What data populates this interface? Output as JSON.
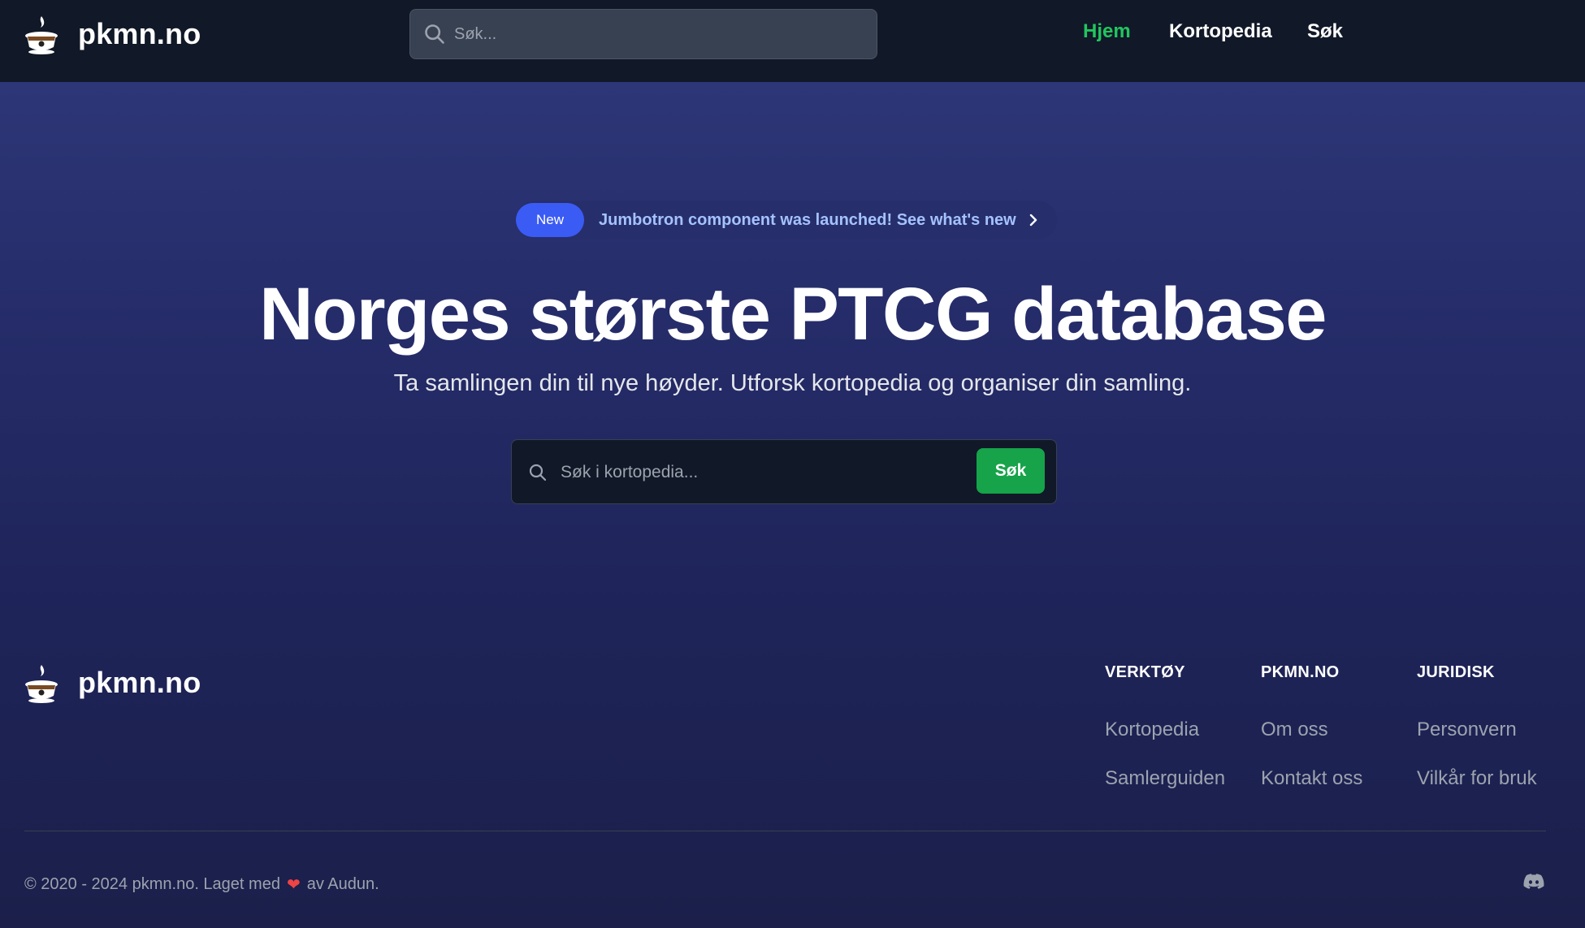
{
  "header": {
    "brand": "pkmn.no",
    "search_placeholder": "Søk...",
    "nav": [
      {
        "label": "Hjem",
        "active": true
      },
      {
        "label": "Kortopedia",
        "active": false
      },
      {
        "label": "Søk",
        "active": false
      }
    ]
  },
  "hero": {
    "badge": "New",
    "announcement": "Jumbotron component was launched! See what's new",
    "title": "Norges største PTCG database",
    "subtitle": "Ta samlingen din til nye høyder. Utforsk kortopedia og organiser din samling.",
    "search_placeholder": "Søk i kortopedia...",
    "search_button": "Søk"
  },
  "footer": {
    "brand": "pkmn.no",
    "columns": [
      {
        "heading": "VERKTØY",
        "links": [
          "Kortopedia",
          "Samlerguiden"
        ]
      },
      {
        "heading": "PKMN.NO",
        "links": [
          "Om oss",
          "Kontakt oss"
        ]
      },
      {
        "heading": "JURIDISK",
        "links": [
          "Personvern",
          "Vilkår for bruk"
        ]
      }
    ],
    "copyright_prefix": "© 2020 - 2024 pkmn.no. Laget med",
    "copyright_suffix": "av Audun.",
    "social_icon": "discord-icon"
  },
  "colors": {
    "header_bg": "#111827",
    "accent_green": "#22c55e",
    "button_green": "#16a34a",
    "badge_blue": "#3b5bf5",
    "hero_bg": "#2d3677"
  }
}
